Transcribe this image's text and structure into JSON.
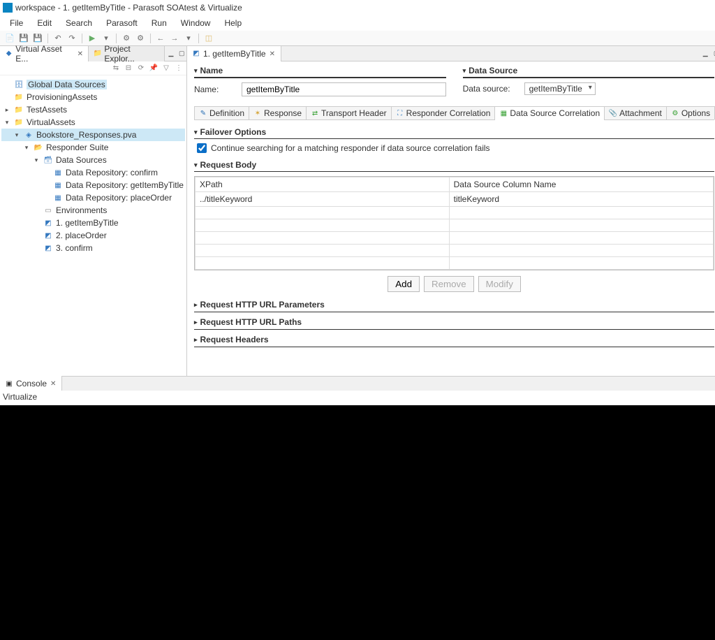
{
  "title": "workspace - 1. getItemByTitle - Parasoft SOAtest & Virtualize",
  "menu": [
    "File",
    "Edit",
    "Search",
    "Parasoft",
    "Run",
    "Window",
    "Help"
  ],
  "leftTabs": {
    "t1": "Virtual Asset E...",
    "t2": "Project Explor..."
  },
  "tree": {
    "n0": "Global Data Sources",
    "n1": "ProvisioningAssets",
    "n2": "TestAssets",
    "n3": "VirtualAssets",
    "n4": "Bookstore_Responses.pva",
    "n5": "Responder Suite",
    "n6": "Data Sources",
    "n7": "Data Repository: confirm",
    "n8": "Data Repository: getItemByTitle",
    "n9": "Data Repository: placeOrder",
    "n10": "Environments",
    "n11": "1. getItemByTitle",
    "n12": "2. placeOrder",
    "n13": "3. confirm"
  },
  "editorTab": "1. getItemByTitle",
  "sections": {
    "name": "Name",
    "dataSource": "Data Source",
    "nameLabel": "Name:",
    "dataSourceLabel": "Data source:",
    "nameValue": "getItemByTitle",
    "dataSourceValue": "getItemByTitle",
    "failover": "Failover Options",
    "failoverCheck": "Continue searching for a matching responder if data source correlation fails",
    "requestBody": "Request Body",
    "reqParams": "Request HTTP URL Parameters",
    "reqPaths": "Request HTTP URL Paths",
    "reqHeaders": "Request Headers"
  },
  "cfgTabs": {
    "t1": "Definition",
    "t2": "Response",
    "t3": "Transport Header",
    "t4": "Responder Correlation",
    "t5": "Data Source Correlation",
    "t6": "Attachment",
    "t7": "Options"
  },
  "table": {
    "h1": "XPath",
    "h2": "Data Source Column Name",
    "r1c1": "../titleKeyword",
    "r1c2": "titleKeyword"
  },
  "buttons": {
    "add": "Add",
    "remove": "Remove",
    "modify": "Modify"
  },
  "console": {
    "tab": "Console",
    "body": "Virtualize"
  }
}
